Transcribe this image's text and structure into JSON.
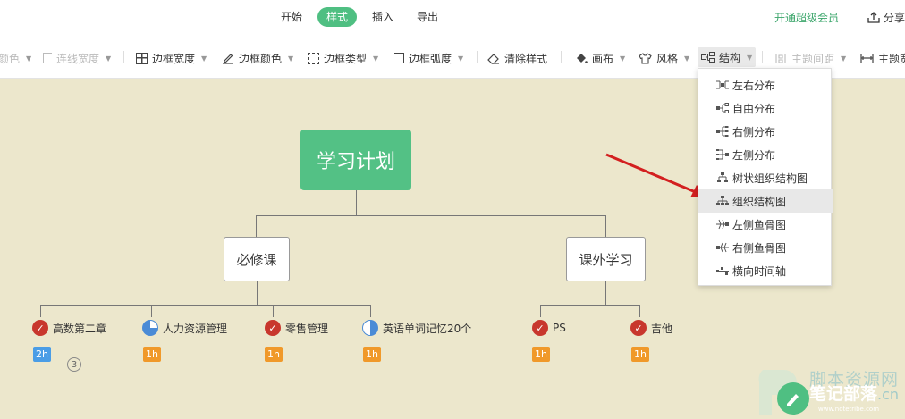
{
  "top_tabs": [
    {
      "label": "开始",
      "active": false
    },
    {
      "label": "样式",
      "active": true
    },
    {
      "label": "插入",
      "active": false
    },
    {
      "label": "导出",
      "active": false
    }
  ],
  "vip_label": "开通超级会员",
  "share_label": "分享",
  "toolbar": {
    "items": [
      {
        "label": "颜色",
        "disabled": true
      },
      {
        "label": "连线宽度",
        "disabled": true
      },
      {
        "label": "边框宽度",
        "disabled": false
      },
      {
        "label": "边框颜色",
        "disabled": false
      },
      {
        "label": "边框类型",
        "disabled": false
      },
      {
        "label": "边框弧度",
        "disabled": false
      },
      {
        "label": "清除样式",
        "disabled": false
      },
      {
        "label": "画布",
        "disabled": false
      },
      {
        "label": "风格",
        "disabled": false
      },
      {
        "label": "结构",
        "disabled": false
      },
      {
        "label": "主题间距",
        "disabled": true
      },
      {
        "label": "主题宽",
        "disabled": false
      }
    ]
  },
  "dropdown": {
    "items": [
      {
        "label": "左右分布",
        "icon": "left-right-layout-icon"
      },
      {
        "label": "自由分布",
        "icon": "free-layout-icon"
      },
      {
        "label": "右侧分布",
        "icon": "right-layout-icon"
      },
      {
        "label": "左侧分布",
        "icon": "left-layout-icon"
      },
      {
        "label": "树状组织结构图",
        "icon": "tree-org-icon"
      },
      {
        "label": "组织结构图",
        "icon": "org-chart-icon",
        "hover": true
      },
      {
        "label": "左侧鱼骨图",
        "icon": "left-fishbone-icon"
      },
      {
        "label": "右侧鱼骨图",
        "icon": "right-fishbone-icon"
      },
      {
        "label": "横向时间轴",
        "icon": "timeline-icon"
      }
    ]
  },
  "mindmap": {
    "root": "学习计划",
    "branches": [
      {
        "label": "必修课"
      },
      {
        "label": "课外学习"
      }
    ],
    "leaves": [
      {
        "label": "高数第二章",
        "marker": "check",
        "badge": "2h",
        "badge_color": "blue"
      },
      {
        "label": "人力资源管理",
        "marker": "pie-75",
        "badge": "1h",
        "badge_color": "orange"
      },
      {
        "label": "零售管理",
        "marker": "check",
        "badge": "1h",
        "badge_color": "orange"
      },
      {
        "label": "英语单词记忆20个",
        "marker": "pie-50",
        "badge": "1h",
        "badge_color": "orange"
      },
      {
        "label": "PS",
        "marker": "check",
        "badge": "1h",
        "badge_color": "orange"
      },
      {
        "label": "吉他",
        "marker": "check",
        "badge": "1h",
        "badge_color": "orange"
      }
    ],
    "collapsed_count": "3"
  },
  "colors": {
    "canvas": "#ece7cc",
    "root_node": "#53c185",
    "check": "#c8372d",
    "badge_orange": "#f0992a",
    "badge_blue": "#4a9de6",
    "arrow": "#d32020"
  },
  "watermark": {
    "site": "脚本资源网",
    "brand": "笔记部落",
    "domain_suffix": ".cn",
    "url": "www.notetribe.com"
  }
}
